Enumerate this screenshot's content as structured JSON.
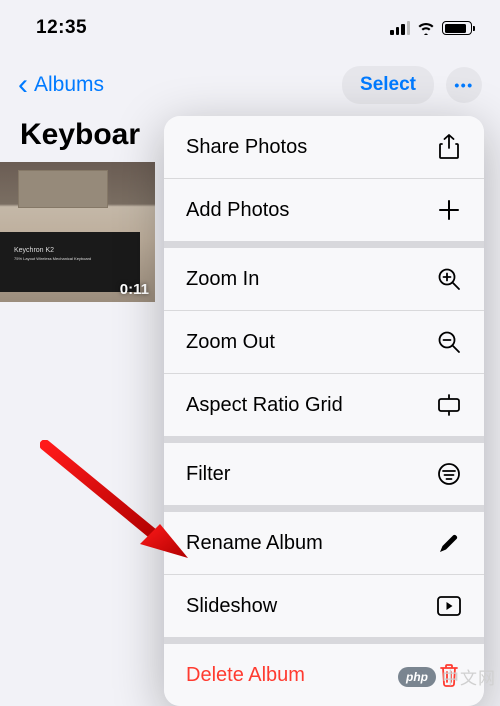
{
  "status": {
    "time": "12:35"
  },
  "nav": {
    "back": "Albums",
    "select": "Select",
    "more": "•••"
  },
  "album": {
    "title": "Keyboar",
    "thumb_brand": "Keychron K2",
    "thumb_sub": "75% Layout Wireless Mechanical Keyboard",
    "thumb_time": "0:11"
  },
  "menu": {
    "share": "Share Photos",
    "add": "Add Photos",
    "zoom_in": "Zoom In",
    "zoom_out": "Zoom Out",
    "aspect": "Aspect Ratio Grid",
    "filter": "Filter",
    "rename": "Rename Album",
    "slideshow": "Slideshow",
    "delete": "Delete Album"
  },
  "watermark": {
    "badge": "php",
    "text": "中文网"
  }
}
